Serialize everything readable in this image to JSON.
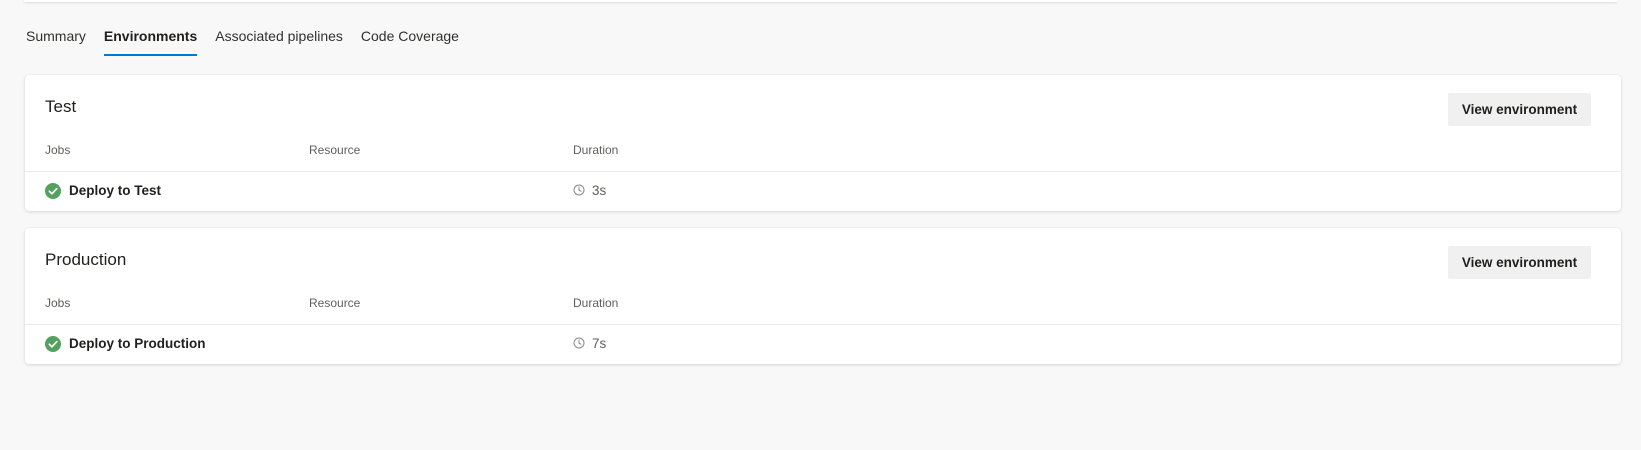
{
  "tabs": [
    {
      "label": "Summary",
      "active": false
    },
    {
      "label": "Environments",
      "active": true
    },
    {
      "label": "Associated pipelines",
      "active": false
    },
    {
      "label": "Code Coverage",
      "active": false
    }
  ],
  "columns": {
    "jobs": "Jobs",
    "resource": "Resource",
    "duration": "Duration"
  },
  "environments": [
    {
      "name": "Test",
      "view_button": "View environment",
      "jobs": [
        {
          "name": "Deploy to Test",
          "status": "succeeded",
          "status_icon": "check-circle-icon",
          "duration": "3s"
        }
      ]
    },
    {
      "name": "Production",
      "view_button": "View environment",
      "jobs": [
        {
          "name": "Deploy to Production",
          "status": "succeeded",
          "status_icon": "check-circle-icon",
          "duration": "7s"
        }
      ]
    }
  ],
  "colors": {
    "accent": "#0078d4",
    "success": "#54a15e",
    "background": "#f8f8f8"
  }
}
